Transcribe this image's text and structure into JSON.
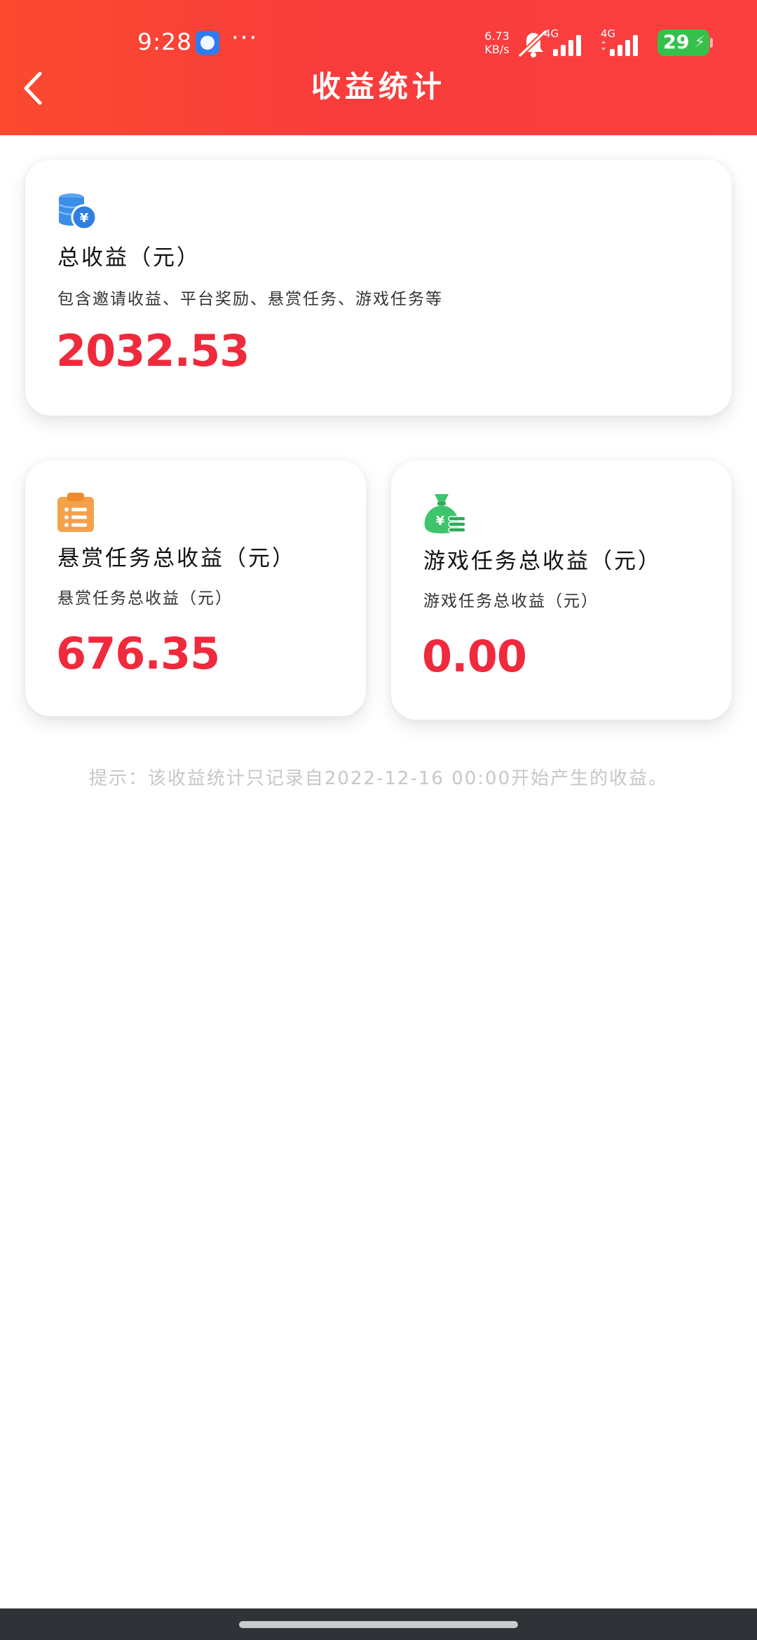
{
  "status_bar": {
    "time": "9:28",
    "more": "···",
    "net_speed_value": "6.73",
    "net_speed_unit": "KB/s",
    "network_label_1": "4G",
    "network_label_2": "4G",
    "battery_level": "29",
    "icons": [
      "app-notification-icon",
      "bell-muted-icon",
      "signal-icon",
      "signal-icon",
      "battery-charging-icon"
    ]
  },
  "header": {
    "title": "收益统计",
    "back_icon": "chevron-left-icon",
    "gradient_start": "#fb4a2f",
    "gradient_end": "#fb3f3f"
  },
  "cards": {
    "total": {
      "icon": "coin-stack-icon",
      "title": "总收益（元）",
      "subtitle": "包含邀请收益、平台奖励、悬赏任务、游戏任务等",
      "amount": "2032.53"
    },
    "bounty": {
      "icon": "clipboard-list-icon",
      "title": "悬赏任务总收益（元）",
      "subtitle": "悬赏任务总收益（元）",
      "amount": "676.35"
    },
    "game": {
      "icon": "money-bag-icon",
      "title": "游戏任务总收益（元）",
      "subtitle": "游戏任务总收益（元）",
      "amount": "0.00"
    }
  },
  "tip": "提示：该收益统计只记录自2022-12-16 00:00开始产生的收益。",
  "colors": {
    "accent_red": "#ef2a3c",
    "tip_gray": "#c7c7c7",
    "coin_blue": "#3b8de8",
    "clipboard_orange": "#f5a04a",
    "bag_green": "#3fc46e"
  }
}
